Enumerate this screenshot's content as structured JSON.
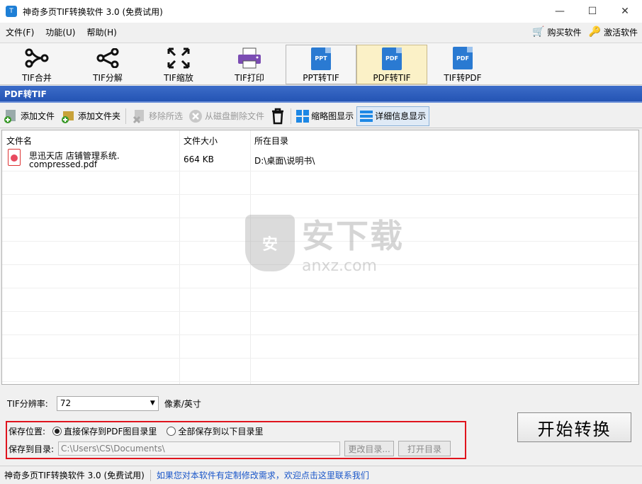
{
  "window": {
    "title": "神奇多页TIF转换软件 3.0 (免费试用)",
    "app_icon_glyph": "T",
    "min_glyph": "—",
    "max_glyph": "☐",
    "close_glyph": "✕"
  },
  "menu": {
    "items": [
      "文件(F)",
      "功能(U)",
      "帮助(H)"
    ],
    "buy": "购买软件",
    "activate": "激活软件"
  },
  "big_toolbar": [
    {
      "label": "TIF合并",
      "icon": "merge-icon"
    },
    {
      "label": "TIF分解",
      "icon": "share-split-icon"
    },
    {
      "label": "TIF缩放",
      "icon": "resize-arrows-icon"
    },
    {
      "label": "TIF打印",
      "icon": "printer-icon"
    },
    {
      "label": "PPT转TIF",
      "icon": "ppt-doc-icon",
      "badge": "PPT"
    },
    {
      "label": "PDF转TIF",
      "icon": "pdf-doc-icon",
      "badge": "PDF"
    },
    {
      "label": "TIF转PDF",
      "icon": "pdf-doc-icon",
      "badge": "PDF"
    }
  ],
  "section_title": "PDF转TIF",
  "small_toolbar": {
    "add_file": "添加文件",
    "add_folder": "添加文件夹",
    "remove_selected": "移除所选",
    "delete_from_disk": "从磁盘删除文件",
    "thumbnail_view": "缩略图显示",
    "detail_view": "详细信息显示"
  },
  "file_list": {
    "columns": [
      "文件名",
      "文件大小",
      "所在目录"
    ],
    "rows": [
      {
        "name_line1": "思迅天店 店铺管理系统.",
        "name_line2": "compressed.pdf",
        "size": "664 KB",
        "dir": "D:\\桌面\\说明书\\"
      }
    ]
  },
  "watermark": {
    "shield": "安",
    "cn": "安下载",
    "en": "anxz.com"
  },
  "settings": {
    "resolution_label": "TIF分辨率:",
    "resolution_value": "72",
    "resolution_unit": "像素/英寸",
    "save_location_label": "保存位置:",
    "option_same_dir": "直接保存到PDF图目录里",
    "option_custom_dir": "全部保存到以下目录里",
    "save_dir_label": "保存到目录:",
    "save_dir_value": "C:\\Users\\CS\\Documents\\",
    "change_dir": "更改目录...",
    "open_dir": "打开目录",
    "selected_option": "same_dir"
  },
  "start_button": "开始转换",
  "status": {
    "text": "神奇多页TIF转换软件 3.0 (免费试用)",
    "link": "如果您对本软件有定制修改需求，欢迎点击这里联系我们"
  },
  "colors": {
    "header_blue": "#2454b4",
    "highlight_red": "#e0141d",
    "link_blue": "#1a56c9"
  }
}
